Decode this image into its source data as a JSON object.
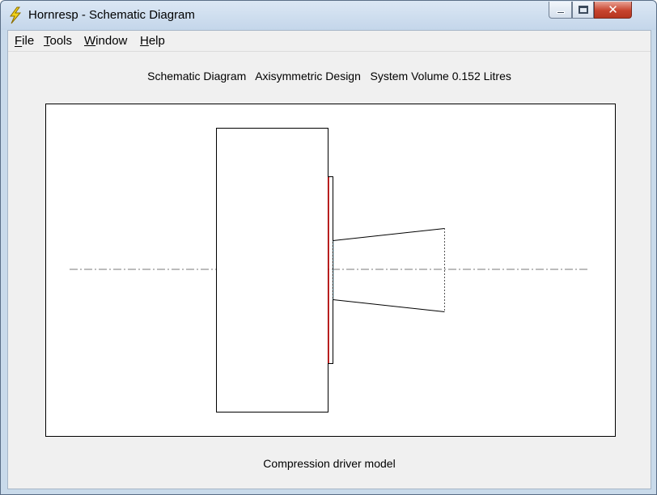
{
  "window": {
    "title": "Hornresp - Schematic Diagram",
    "icon": "lightning-bolt-icon",
    "controls": {
      "minimize": "minimize-icon",
      "maximize": "maximize-icon",
      "close": "close-icon"
    }
  },
  "menu": {
    "file": "File",
    "tools": "Tools",
    "window": "Window",
    "help": "Help"
  },
  "heading": "Schematic Diagram   Axisymmetric Design   System Volume 0.152 Litres",
  "caption": "Compression driver model",
  "colors": {
    "diaphragm": "#cc0000",
    "throat_line": "#7fb0c0",
    "axis": "#7a7a7a"
  }
}
